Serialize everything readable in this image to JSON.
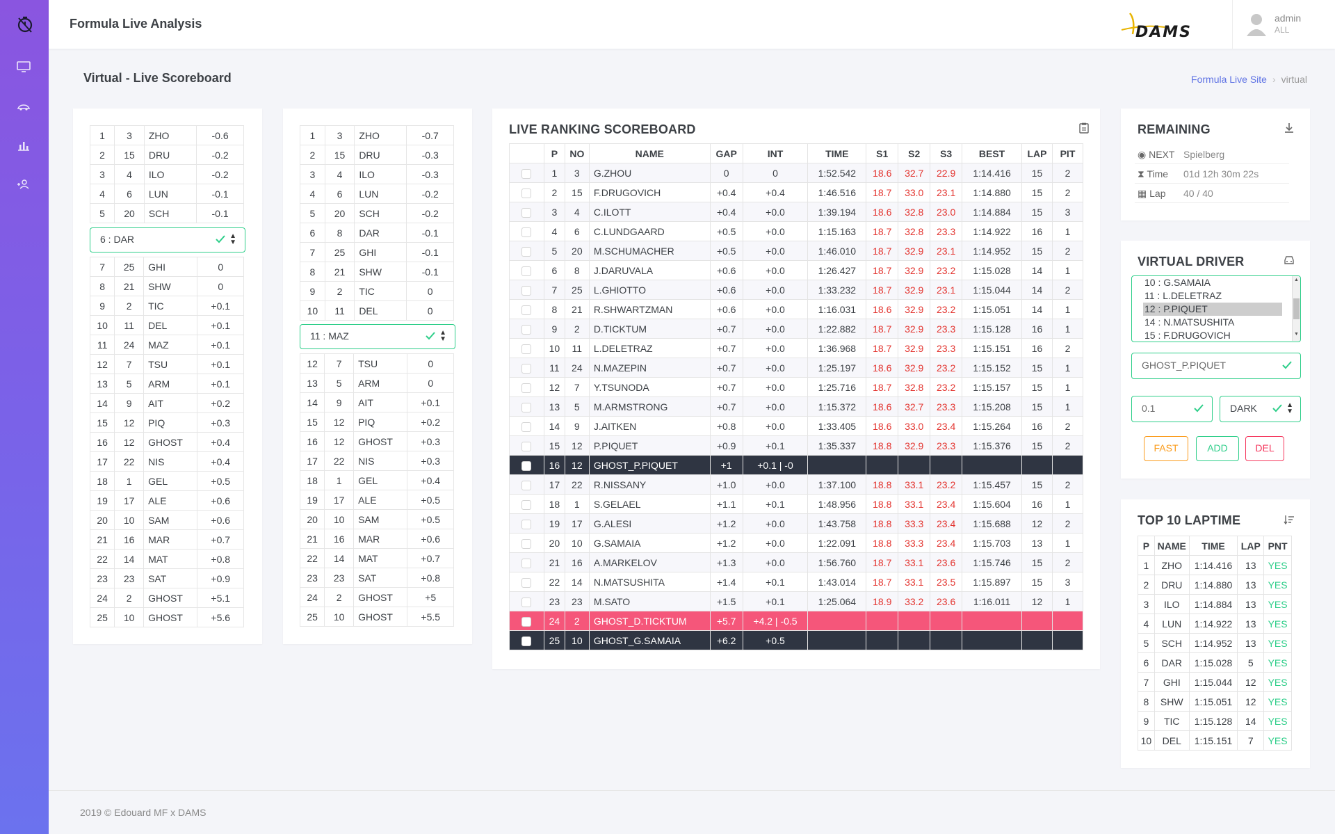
{
  "app": {
    "title": "Formula Live Analysis",
    "brand": "DAMS"
  },
  "user": {
    "name": "admin",
    "role": "ALL"
  },
  "page": {
    "title": "Virtual - Live Scoreboard"
  },
  "breadcrumb": {
    "home": "Formula Live Site",
    "current": "virtual"
  },
  "panel1": {
    "top": [
      [
        "1",
        "3",
        "ZHO",
        "-0.6"
      ],
      [
        "2",
        "15",
        "DRU",
        "-0.2"
      ],
      [
        "3",
        "4",
        "ILO",
        "-0.2"
      ],
      [
        "4",
        "6",
        "LUN",
        "-0.1"
      ],
      [
        "5",
        "20",
        "SCH",
        "-0.1"
      ]
    ],
    "selected": "6 : DAR",
    "bottom": [
      [
        "7",
        "25",
        "GHI",
        "0"
      ],
      [
        "8",
        "21",
        "SHW",
        "0"
      ],
      [
        "9",
        "2",
        "TIC",
        "+0.1"
      ],
      [
        "10",
        "11",
        "DEL",
        "+0.1"
      ],
      [
        "11",
        "24",
        "MAZ",
        "+0.1"
      ],
      [
        "12",
        "7",
        "TSU",
        "+0.1"
      ],
      [
        "13",
        "5",
        "ARM",
        "+0.1"
      ],
      [
        "14",
        "9",
        "AIT",
        "+0.2"
      ],
      [
        "15",
        "12",
        "PIQ",
        "+0.3"
      ],
      [
        "16",
        "12",
        "GHOST",
        "+0.4"
      ],
      [
        "17",
        "22",
        "NIS",
        "+0.4"
      ],
      [
        "18",
        "1",
        "GEL",
        "+0.5"
      ],
      [
        "19",
        "17",
        "ALE",
        "+0.6"
      ],
      [
        "20",
        "10",
        "SAM",
        "+0.6"
      ],
      [
        "21",
        "16",
        "MAR",
        "+0.7"
      ],
      [
        "22",
        "14",
        "MAT",
        "+0.8"
      ],
      [
        "23",
        "23",
        "SAT",
        "+0.9"
      ],
      [
        "24",
        "2",
        "GHOST",
        "+5.1"
      ],
      [
        "25",
        "10",
        "GHOST",
        "+5.6"
      ]
    ]
  },
  "panel2": {
    "top": [
      [
        "1",
        "3",
        "ZHO",
        "-0.7"
      ],
      [
        "2",
        "15",
        "DRU",
        "-0.3"
      ],
      [
        "3",
        "4",
        "ILO",
        "-0.3"
      ],
      [
        "4",
        "6",
        "LUN",
        "-0.2"
      ],
      [
        "5",
        "20",
        "SCH",
        "-0.2"
      ],
      [
        "6",
        "8",
        "DAR",
        "-0.1"
      ],
      [
        "7",
        "25",
        "GHI",
        "-0.1"
      ],
      [
        "8",
        "21",
        "SHW",
        "-0.1"
      ],
      [
        "9",
        "2",
        "TIC",
        "0"
      ],
      [
        "10",
        "11",
        "DEL",
        "0"
      ]
    ],
    "selected": "11 : MAZ",
    "bottom": [
      [
        "12",
        "7",
        "TSU",
        "0"
      ],
      [
        "13",
        "5",
        "ARM",
        "0"
      ],
      [
        "14",
        "9",
        "AIT",
        "+0.1"
      ],
      [
        "15",
        "12",
        "PIQ",
        "+0.2"
      ],
      [
        "16",
        "12",
        "GHOST",
        "+0.3"
      ],
      [
        "17",
        "22",
        "NIS",
        "+0.3"
      ],
      [
        "18",
        "1",
        "GEL",
        "+0.4"
      ],
      [
        "19",
        "17",
        "ALE",
        "+0.5"
      ],
      [
        "20",
        "10",
        "SAM",
        "+0.5"
      ],
      [
        "21",
        "16",
        "MAR",
        "+0.6"
      ],
      [
        "22",
        "14",
        "MAT",
        "+0.7"
      ],
      [
        "23",
        "23",
        "SAT",
        "+0.8"
      ],
      [
        "24",
        "2",
        "GHOST",
        "+5"
      ],
      [
        "25",
        "10",
        "GHOST",
        "+5.5"
      ]
    ]
  },
  "ranking": {
    "title": "LIVE RANKING SCOREBOARD",
    "headers": [
      "",
      "P",
      "NO",
      "NAME",
      "GAP",
      "INT",
      "TIME",
      "S1",
      "S2",
      "S3",
      "BEST",
      "LAP",
      "PIT"
    ],
    "rows": [
      {
        "p": "1",
        "no": "3",
        "name": "G.ZHOU",
        "gap": "0",
        "int": "0",
        "time": "1:52.542",
        "s1": "18.6",
        "s2": "32.7",
        "s3": "22.9",
        "best": "1:14.416",
        "lap": "15",
        "pit": "2",
        "style": "normal"
      },
      {
        "p": "2",
        "no": "15",
        "name": "F.DRUGOVICH",
        "gap": "+0.4",
        "int": "+0.4",
        "time": "1:46.516",
        "s1": "18.7",
        "s2": "33.0",
        "s3": "23.1",
        "best": "1:14.880",
        "lap": "15",
        "pit": "2",
        "style": "normal"
      },
      {
        "p": "3",
        "no": "4",
        "name": "C.ILOTT",
        "gap": "+0.4",
        "int": "+0.0",
        "time": "1:39.194",
        "s1": "18.6",
        "s2": "32.8",
        "s3": "23.0",
        "best": "1:14.884",
        "lap": "15",
        "pit": "3",
        "style": "normal"
      },
      {
        "p": "4",
        "no": "6",
        "name": "C.LUNDGAARD",
        "gap": "+0.5",
        "int": "+0.0",
        "time": "1:15.163",
        "s1": "18.7",
        "s2": "32.8",
        "s3": "23.3",
        "best": "1:14.922",
        "lap": "16",
        "pit": "1",
        "style": "normal"
      },
      {
        "p": "5",
        "no": "20",
        "name": "M.SCHUMACHER",
        "gap": "+0.5",
        "int": "+0.0",
        "time": "1:46.010",
        "s1": "18.7",
        "s2": "32.9",
        "s3": "23.1",
        "best": "1:14.952",
        "lap": "15",
        "pit": "2",
        "style": "normal"
      },
      {
        "p": "6",
        "no": "8",
        "name": "J.DARUVALA",
        "gap": "+0.6",
        "int": "+0.0",
        "time": "1:26.427",
        "s1": "18.7",
        "s2": "32.9",
        "s3": "23.2",
        "best": "1:15.028",
        "lap": "14",
        "pit": "1",
        "style": "normal"
      },
      {
        "p": "7",
        "no": "25",
        "name": "L.GHIOTTO",
        "gap": "+0.6",
        "int": "+0.0",
        "time": "1:33.232",
        "s1": "18.7",
        "s2": "32.9",
        "s3": "23.1",
        "best": "1:15.044",
        "lap": "14",
        "pit": "2",
        "style": "normal"
      },
      {
        "p": "8",
        "no": "21",
        "name": "R.SHWARTZMAN",
        "gap": "+0.6",
        "int": "+0.0",
        "time": "1:16.031",
        "s1": "18.6",
        "s2": "32.9",
        "s3": "23.2",
        "best": "1:15.051",
        "lap": "14",
        "pit": "1",
        "style": "normal"
      },
      {
        "p": "9",
        "no": "2",
        "name": "D.TICKTUM",
        "gap": "+0.7",
        "int": "+0.0",
        "time": "1:22.882",
        "s1": "18.7",
        "s2": "32.9",
        "s3": "23.3",
        "best": "1:15.128",
        "lap": "16",
        "pit": "1",
        "style": "normal"
      },
      {
        "p": "10",
        "no": "11",
        "name": "L.DELETRAZ",
        "gap": "+0.7",
        "int": "+0.0",
        "time": "1:36.968",
        "s1": "18.7",
        "s2": "32.9",
        "s3": "23.3",
        "best": "1:15.151",
        "lap": "16",
        "pit": "2",
        "style": "normal"
      },
      {
        "p": "11",
        "no": "24",
        "name": "N.MAZEPIN",
        "gap": "+0.7",
        "int": "+0.0",
        "time": "1:25.197",
        "s1": "18.6",
        "s2": "32.9",
        "s3": "23.2",
        "best": "1:15.152",
        "lap": "15",
        "pit": "1",
        "style": "normal"
      },
      {
        "p": "12",
        "no": "7",
        "name": "Y.TSUNODA",
        "gap": "+0.7",
        "int": "+0.0",
        "time": "1:25.716",
        "s1": "18.7",
        "s2": "32.8",
        "s3": "23.2",
        "best": "1:15.157",
        "lap": "15",
        "pit": "1",
        "style": "normal"
      },
      {
        "p": "13",
        "no": "5",
        "name": "M.ARMSTRONG",
        "gap": "+0.7",
        "int": "+0.0",
        "time": "1:15.372",
        "s1": "18.6",
        "s2": "32.7",
        "s3": "23.3",
        "best": "1:15.208",
        "lap": "15",
        "pit": "1",
        "style": "normal"
      },
      {
        "p": "14",
        "no": "9",
        "name": "J.AITKEN",
        "gap": "+0.8",
        "int": "+0.0",
        "time": "1:33.405",
        "s1": "18.6",
        "s2": "33.0",
        "s3": "23.4",
        "best": "1:15.264",
        "lap": "16",
        "pit": "2",
        "style": "normal"
      },
      {
        "p": "15",
        "no": "12",
        "name": "P.PIQUET",
        "gap": "+0.9",
        "int": "+0.1",
        "time": "1:35.337",
        "s1": "18.8",
        "s2": "32.9",
        "s3": "23.3",
        "best": "1:15.376",
        "lap": "15",
        "pit": "2",
        "style": "normal"
      },
      {
        "p": "16",
        "no": "12",
        "name": "GHOST_P.PIQUET",
        "gap": "+1",
        "int": "+0.1 | -0",
        "time": "",
        "s1": "",
        "s2": "",
        "s3": "",
        "best": "",
        "lap": "",
        "pit": "",
        "style": "dark"
      },
      {
        "p": "17",
        "no": "22",
        "name": "R.NISSANY",
        "gap": "+1.0",
        "int": "+0.0",
        "time": "1:37.100",
        "s1": "18.8",
        "s2": "33.1",
        "s3": "23.2",
        "best": "1:15.457",
        "lap": "15",
        "pit": "2",
        "style": "normal"
      },
      {
        "p": "18",
        "no": "1",
        "name": "S.GELAEL",
        "gap": "+1.1",
        "int": "+0.1",
        "time": "1:48.956",
        "s1": "18.8",
        "s2": "33.1",
        "s3": "23.4",
        "best": "1:15.604",
        "lap": "16",
        "pit": "1",
        "style": "normal"
      },
      {
        "p": "19",
        "no": "17",
        "name": "G.ALESI",
        "gap": "+1.2",
        "int": "+0.0",
        "time": "1:43.758",
        "s1": "18.8",
        "s2": "33.3",
        "s3": "23.4",
        "best": "1:15.688",
        "lap": "12",
        "pit": "2",
        "style": "normal"
      },
      {
        "p": "20",
        "no": "10",
        "name": "G.SAMAIA",
        "gap": "+1.2",
        "int": "+0.0",
        "time": "1:22.091",
        "s1": "18.8",
        "s2": "33.3",
        "s3": "23.4",
        "best": "1:15.703",
        "lap": "13",
        "pit": "1",
        "style": "normal"
      },
      {
        "p": "21",
        "no": "16",
        "name": "A.MARKELOV",
        "gap": "+1.3",
        "int": "+0.0",
        "time": "1:56.760",
        "s1": "18.7",
        "s2": "33.1",
        "s3": "23.6",
        "best": "1:15.746",
        "lap": "15",
        "pit": "2",
        "style": "normal"
      },
      {
        "p": "22",
        "no": "14",
        "name": "N.MATSUSHITA",
        "gap": "+1.4",
        "int": "+0.1",
        "time": "1:43.014",
        "s1": "18.7",
        "s2": "33.1",
        "s3": "23.5",
        "best": "1:15.897",
        "lap": "15",
        "pit": "3",
        "style": "normal"
      },
      {
        "p": "23",
        "no": "23",
        "name": "M.SATO",
        "gap": "+1.5",
        "int": "+0.1",
        "time": "1:25.064",
        "s1": "18.9",
        "s2": "33.2",
        "s3": "23.6",
        "best": "1:16.011",
        "lap": "12",
        "pit": "1",
        "style": "normal"
      },
      {
        "p": "24",
        "no": "2",
        "name": "GHOST_D.TICKTUM",
        "gap": "+5.7",
        "int": "+4.2 | -0.5",
        "time": "",
        "s1": "",
        "s2": "",
        "s3": "",
        "best": "",
        "lap": "",
        "pit": "",
        "style": "pink"
      },
      {
        "p": "25",
        "no": "10",
        "name": "GHOST_G.SAMAIA",
        "gap": "+6.2",
        "int": "+0.5",
        "time": "",
        "s1": "",
        "s2": "",
        "s3": "",
        "best": "",
        "lap": "",
        "pit": "",
        "style": "dark"
      }
    ]
  },
  "remaining": {
    "title": "REMAINING",
    "next_label": "NEXT",
    "next_value": "Spielberg",
    "time_label": "Time",
    "time_value": "01d 12h 30m 22s",
    "lap_label": "Lap",
    "lap_value": "40 / 40"
  },
  "virtual_driver": {
    "title": "VIRTUAL DRIVER",
    "options": [
      "10 : G.SAMAIA",
      "11 : L.DELETRAZ",
      "12 : P.PIQUET",
      "14 : N.MATSUSHITA",
      "15 : F.DRUGOVICH"
    ],
    "selected_option": "12 : P.PIQUET",
    "ghost_name": "GHOST_P.PIQUET",
    "delta": "0.1",
    "mode": "DARK",
    "buttons": {
      "fast": "FAST",
      "add": "ADD",
      "del": "DEL"
    }
  },
  "top10": {
    "title": "TOP 10 LAPTIME",
    "headers": [
      "P",
      "NAME",
      "TIME",
      "LAP",
      "PNT"
    ],
    "rows": [
      [
        "1",
        "ZHO",
        "1:14.416",
        "13",
        "YES"
      ],
      [
        "2",
        "DRU",
        "1:14.880",
        "13",
        "YES"
      ],
      [
        "3",
        "ILO",
        "1:14.884",
        "13",
        "YES"
      ],
      [
        "4",
        "LUN",
        "1:14.922",
        "13",
        "YES"
      ],
      [
        "5",
        "SCH",
        "1:14.952",
        "13",
        "YES"
      ],
      [
        "6",
        "DAR",
        "1:15.028",
        "5",
        "YES"
      ],
      [
        "7",
        "GHI",
        "1:15.044",
        "12",
        "YES"
      ],
      [
        "8",
        "SHW",
        "1:15.051",
        "12",
        "YES"
      ],
      [
        "9",
        "TIC",
        "1:15.128",
        "14",
        "YES"
      ],
      [
        "10",
        "DEL",
        "1:15.151",
        "7",
        "YES"
      ]
    ]
  },
  "footer": {
    "text": "2019 © Edouard MF x DAMS"
  },
  "colors": {
    "accent": "#5e72e4",
    "success": "#2dce89",
    "danger": "#f5567a",
    "warning": "#fb9b1a",
    "dark_row": "#2f3542",
    "sector_red": "#e3342f"
  },
  "icons": {
    "sidebar": [
      "stopwatch-icon",
      "monitor-icon",
      "car-icon",
      "bar-chart-icon",
      "user-add-icon"
    ]
  }
}
